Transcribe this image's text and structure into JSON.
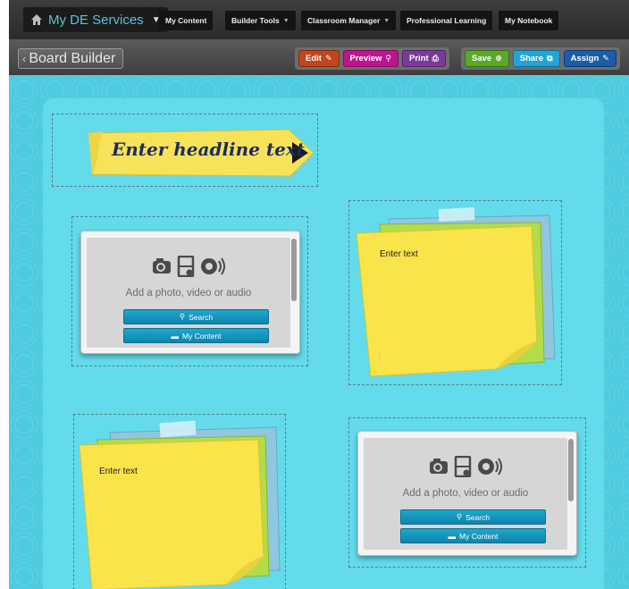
{
  "topnav": {
    "services_label": "My DE Services",
    "tabs": [
      {
        "label": "My Content",
        "caret": ""
      },
      {
        "label": "Builder Tools",
        "caret": "▼"
      },
      {
        "label": "Classroom Manager",
        "caret": "▼"
      },
      {
        "label": "Professional Learning",
        "caret": ""
      },
      {
        "label": "My Notebook",
        "caret": ""
      }
    ]
  },
  "builder": {
    "title": "Board Builder",
    "back_glyph": "‹",
    "buttons": {
      "edit": {
        "label": "Edit",
        "icon": "✎",
        "color": "#c4441b"
      },
      "preview": {
        "label": "Preview",
        "icon": "⚲",
        "color": "#c0138f"
      },
      "print": {
        "label": "Print",
        "icon": "⎙",
        "color": "#7a3a9a"
      },
      "save": {
        "label": "Save",
        "icon": "⊕",
        "color": "#5aa925"
      },
      "share": {
        "label": "Share",
        "icon": "⧉",
        "color": "#21a5d8"
      },
      "assign": {
        "label": "Assign",
        "icon": "✎",
        "color": "#1a5da8"
      }
    }
  },
  "board": {
    "headline": "Enter headline text",
    "media_cards": [
      {
        "label": "Add a photo, video or audio",
        "search_label": "Search",
        "content_label": "My Content"
      },
      {
        "label": "Add a photo, video or audio",
        "search_label": "Search",
        "content_label": "My Content"
      }
    ],
    "notes": [
      {
        "text": "Enter text"
      },
      {
        "text": "Enter text"
      }
    ]
  },
  "colors": {
    "board_bg": "#4fcbe0",
    "note_yellow": "#f9e44a",
    "headline_yellow": "#f7e35a",
    "button_blue": "#1497c0"
  }
}
